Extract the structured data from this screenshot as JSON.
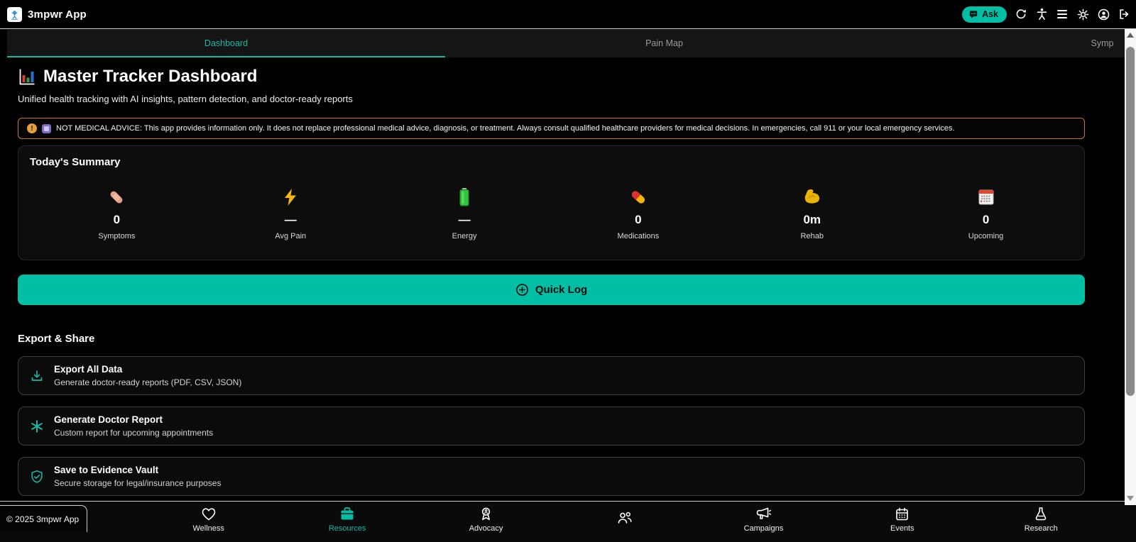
{
  "app": {
    "title": "3mpwr App",
    "logo_icon": "raised-arms-person-logo"
  },
  "topbar": {
    "ask_label": "Ask",
    "icons": [
      "chat-bubble-icon",
      "refresh-icon",
      "accessibility-icon",
      "menu-icon",
      "settings-gear-icon",
      "account-icon",
      "logout-icon"
    ]
  },
  "tabs": [
    {
      "label": "Dashboard",
      "active": true
    },
    {
      "label": "Pain Map",
      "active": false
    },
    {
      "label": "Symp",
      "active": false,
      "note_truncated": true
    }
  ],
  "page": {
    "title": "Master Tracker Dashboard",
    "title_icon": "bar-chart-icon",
    "subtitle": "Unified health tracking with AI insights, pattern detection, and doctor-ready reports"
  },
  "disclaimer": {
    "icons": [
      "warning-exclamation-icon",
      "purple-badge-icon"
    ],
    "text": "NOT MEDICAL ADVICE: This app provides information only. It does not replace professional medical advice, diagnosis, or treatment. Always consult qualified healthcare providers for medical decisions. In emergencies, call 911 or your local emergency services."
  },
  "summary": {
    "heading": "Today's Summary",
    "stats": [
      {
        "icon": "bandage-icon",
        "value": "0",
        "label": "Symptoms"
      },
      {
        "icon": "lightning-icon",
        "value": "—",
        "label": "Avg Pain"
      },
      {
        "icon": "battery-icon",
        "value": "—",
        "label": "Energy"
      },
      {
        "icon": "pill-icon",
        "value": "0",
        "label": "Medications"
      },
      {
        "icon": "biceps-icon",
        "value": "0m",
        "label": "Rehab"
      },
      {
        "icon": "calendar-icon",
        "value": "0",
        "label": "Upcoming"
      }
    ]
  },
  "quick_log": {
    "icon": "circle-plus-icon",
    "label": "Quick Log"
  },
  "export_share": {
    "heading": "Export & Share",
    "cards": [
      {
        "icon": "download-icon",
        "title": "Export All Data",
        "subtitle": "Generate doctor-ready reports (PDF, CSV, JSON)"
      },
      {
        "icon": "asterisk-icon",
        "title": "Generate Doctor Report",
        "subtitle": "Custom report for upcoming appointments"
      },
      {
        "icon": "shield-check-icon",
        "title": "Save to Evidence Vault",
        "subtitle": "Secure storage for legal/insurance purposes"
      }
    ]
  },
  "bottom_nav": {
    "items": [
      {
        "icon": "heart-icon",
        "label": "Wellness",
        "active": false
      },
      {
        "icon": "briefcase-icon",
        "label": "Resources",
        "active": true
      },
      {
        "icon": "award-icon",
        "label": "Advocacy",
        "active": false
      },
      {
        "icon": "users-icon",
        "label": "",
        "active": false
      },
      {
        "icon": "megaphone-icon",
        "label": "Campaigns",
        "active": false
      },
      {
        "icon": "calendar-icon",
        "label": "Events",
        "active": false
      },
      {
        "icon": "flask-icon",
        "label": "Research",
        "active": false
      }
    ]
  },
  "footer": {
    "copyright": "© 2025 3mpwr App"
  },
  "colors": {
    "accent_button": "#00bfa5",
    "accent_text": "#14b8a6",
    "warning_border": "#c87a1d",
    "background": "#000000",
    "card_background": "#0d0d0d"
  }
}
